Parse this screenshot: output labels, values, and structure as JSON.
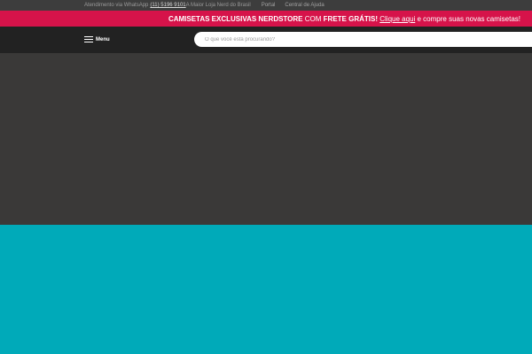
{
  "topbar": {
    "whatsapp_label": "Atendimento via WhatsApp",
    "whatsapp_number": "(11) 5196 9101",
    "tagline": "A Maior Loja Nerd do Brasil",
    "links": [
      "Portal",
      "Central de Ajuda"
    ]
  },
  "promo": {
    "headline": "CAMISETAS EXCLUSIVAS NERDSTORE",
    "connector": "COM",
    "highlight": "FRETE GRÁTIS!",
    "cta": "Clique aqui",
    "tail": "e compre suas novas camisetas!"
  },
  "header": {
    "menu_label": "Menu",
    "search_placeholder": "O que você está procurando?"
  },
  "colors": {
    "promo_bg": "#d6134a",
    "header_bg": "#222222",
    "hero_dark": "#3a3938",
    "hero_teal": "#00aab9"
  }
}
